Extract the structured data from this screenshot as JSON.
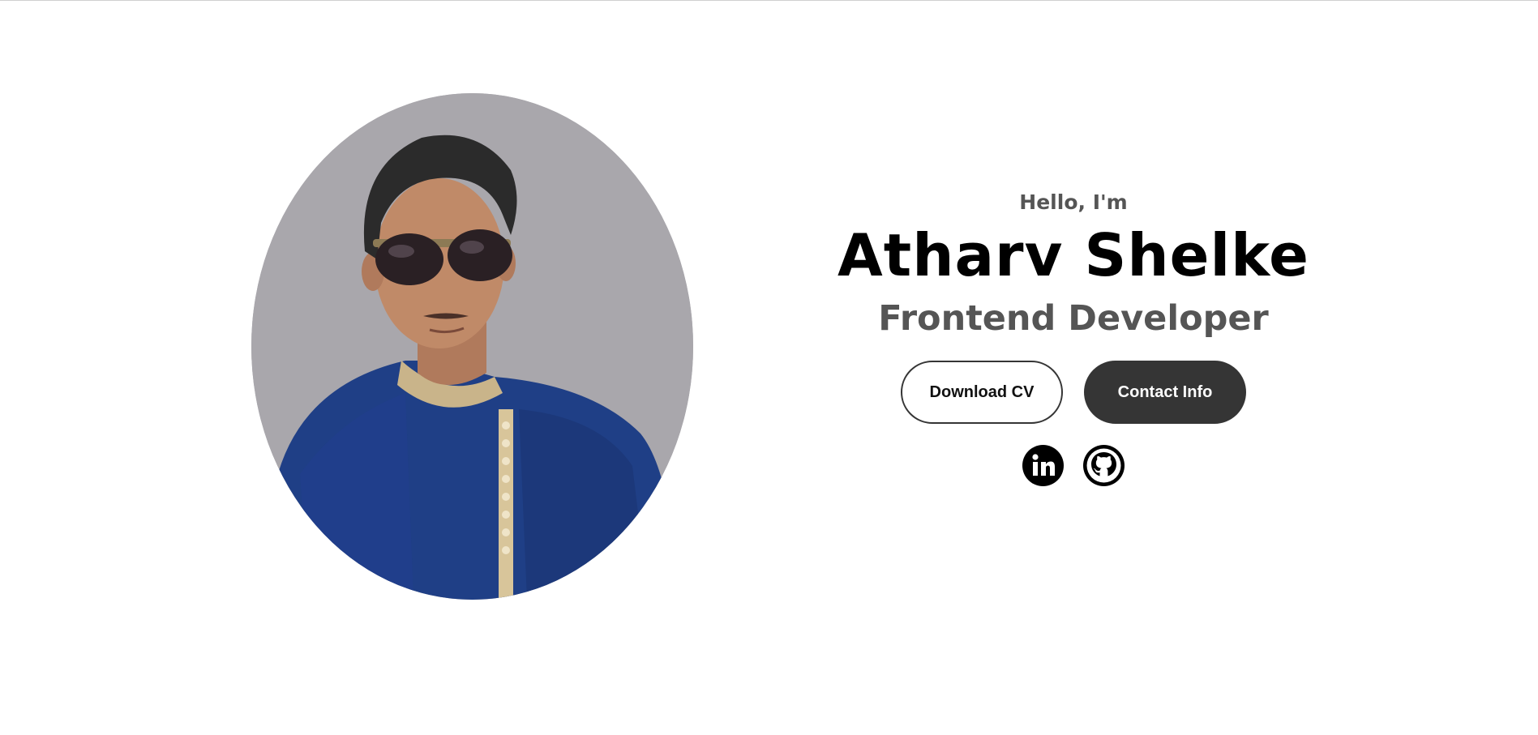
{
  "hero": {
    "profile_image_alt": "Profile picture",
    "greeting": "Hello, I'm",
    "name": "Atharv Shelke",
    "role": "Frontend Developer",
    "buttons": {
      "download_cv": "Download CV",
      "contact_info": "Contact Info"
    },
    "socials": [
      {
        "label": "LinkedIn",
        "icon": "linkedin-icon"
      },
      {
        "label": "GitHub",
        "icon": "github-icon"
      }
    ]
  },
  "colors": {
    "background": "#ffffff",
    "text_primary": "#000000",
    "text_secondary": "#555555",
    "button_dark": "#353535",
    "photo_background": "#a9a7ac",
    "shirt_blue": "#1e3a8a"
  }
}
